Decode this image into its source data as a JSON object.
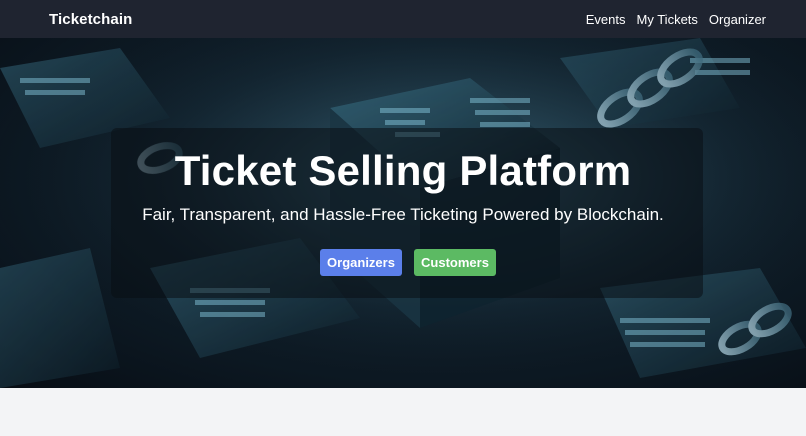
{
  "navbar": {
    "brand": "Ticketchain",
    "links": [
      "Events",
      "My Tickets",
      "Organizer"
    ]
  },
  "hero": {
    "title": "Ticket Selling Platform",
    "subtitle": "Fair, Transparent, and Hassle-Free Ticketing Powered by Blockchain.",
    "buttons": {
      "organizers": "Organizers",
      "customers": "Customers"
    }
  },
  "colors": {
    "navbar_bg": "#1f2430",
    "organizers_button": "#5b7fea",
    "customers_button": "#5cba63",
    "page_bg": "#f3f4f6"
  }
}
